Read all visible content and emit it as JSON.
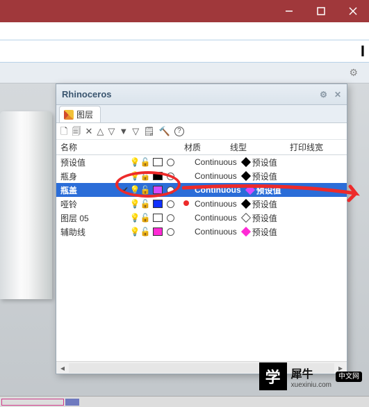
{
  "window": {
    "minimize_label": "—",
    "maximize_label": "❐",
    "close_label": "✕"
  },
  "panel": {
    "title": "Rhinoceros",
    "gear": "⚙",
    "close": "✕",
    "tab_label": "图层"
  },
  "toolbar_icons": {
    "new": "🗋",
    "copy": "🗐",
    "delete": "✕",
    "up": "△",
    "down": "▽",
    "filter": "▼",
    "funnel": "▽",
    "props": "🗒",
    "hammer": "🔨",
    "help": "?"
  },
  "columns": {
    "name": "名称",
    "material": "材质",
    "linetype": "线型",
    "printwidth": "打印线宽"
  },
  "layers": [
    {
      "name": "预设值",
      "current": false,
      "bulb": "yellow",
      "color": "#ffffff",
      "circle": "none",
      "linetype": "Continuous",
      "dia": "#000",
      "pw": "预设值",
      "sel": false
    },
    {
      "name": "瓶身",
      "current": false,
      "bulb": "yellow",
      "color": "#000000",
      "circle": "none",
      "linetype": "Continuous",
      "dia": "#000",
      "pw": "预设值",
      "sel": false
    },
    {
      "name": "瓶盖",
      "current": true,
      "bulb": "yellow",
      "color": "#d54aff",
      "circle": "#fff",
      "linetype": "Continuous",
      "dia": "#d54aff",
      "pw": "预设值",
      "sel": true
    },
    {
      "name": "哑铃",
      "current": false,
      "bulb": "blue",
      "color": "#1030ff",
      "circle": "none",
      "linetype": "Continuous",
      "dia": "#000",
      "pw": "预设值",
      "sel": false
    },
    {
      "name": "图层 05",
      "current": false,
      "bulb": "yellow",
      "color": "#ffffff",
      "circle": "none",
      "linetype": "Continuous",
      "dia": "none",
      "pw": "预设值",
      "sel": false
    },
    {
      "name": "辅助线",
      "current": false,
      "bulb": "blue",
      "color": "#ff2ad5",
      "circle": "none",
      "linetype": "Continuous",
      "dia": "#ff2ad5",
      "pw": "预设值",
      "sel": false
    }
  ],
  "watermark": {
    "big": "学",
    "text": "犀牛",
    "url": "xuexiniu.com",
    "badge": "中文网"
  }
}
